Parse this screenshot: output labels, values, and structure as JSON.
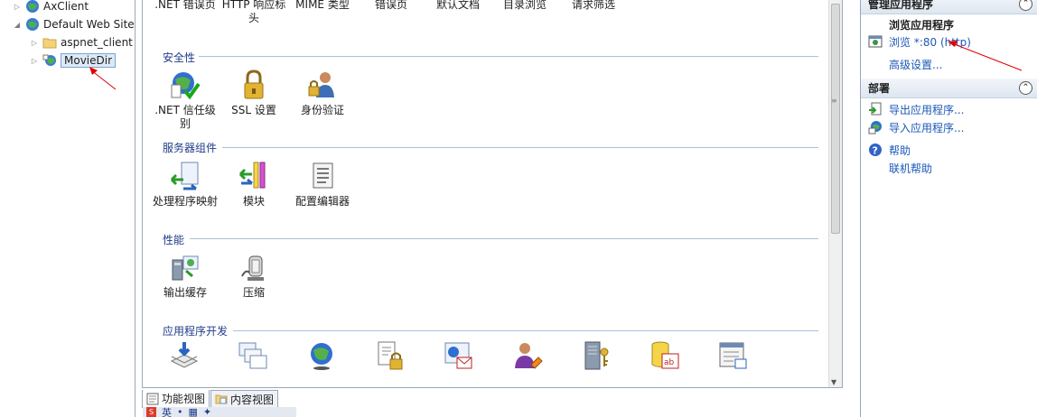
{
  "tree": {
    "items": [
      {
        "label": "AxClient"
      },
      {
        "label": "Default Web Site"
      },
      {
        "label": "aspnet_client"
      },
      {
        "label": "MovieDir"
      }
    ]
  },
  "features": {
    "top_row": [
      {
        "label": ".NET 错误页"
      },
      {
        "label": "HTTP 响应标头"
      },
      {
        "label": "MIME 类型"
      },
      {
        "label": "错误页"
      },
      {
        "label": "默认文档"
      },
      {
        "label": "目录浏览"
      },
      {
        "label": "请求筛选"
      }
    ],
    "groups": [
      {
        "title": "安全性",
        "items": [
          {
            "label": ".NET 信任级别"
          },
          {
            "label": "SSL 设置"
          },
          {
            "label": "身份验证"
          }
        ]
      },
      {
        "title": "服务器组件",
        "items": [
          {
            "label": "处理程序映射"
          },
          {
            "label": "模块"
          },
          {
            "label": "配置编辑器"
          }
        ]
      },
      {
        "title": "性能",
        "items": [
          {
            "label": "输出缓存"
          },
          {
            "label": "压缩"
          }
        ]
      },
      {
        "title": "应用程序开发",
        "items": []
      }
    ]
  },
  "tabs": {
    "features_view": "功能视图",
    "content_view": "内容视图"
  },
  "ime": {
    "label": "英"
  },
  "actions": {
    "manage_app": {
      "title": "管理应用程序",
      "browse_app": "浏览应用程序",
      "browse_link": "浏览 *:80 (http)",
      "advanced": "高级设置..."
    },
    "deploy": {
      "title": "部署",
      "export": "导出应用程序...",
      "import": "导入应用程序..."
    },
    "help": {
      "help": "帮助",
      "online_help": "联机帮助"
    }
  },
  "colors": {
    "link": "#1b58b8",
    "group_title": "#1f3c88",
    "annotation_arrow": "#e00000"
  }
}
